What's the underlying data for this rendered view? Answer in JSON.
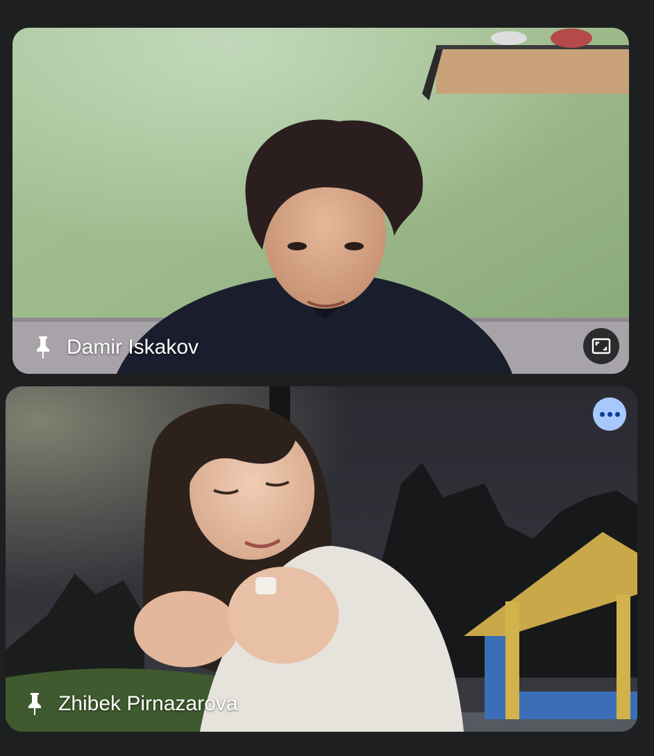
{
  "participants": [
    {
      "name": "Damir Iskakov"
    },
    {
      "name": "Zhibek Pirnazarova"
    }
  ],
  "icons": {
    "pin": "pin-icon",
    "fullscreen": "fullscreen-icon",
    "more": "more-options-icon"
  },
  "colors": {
    "background": "#1e1f20",
    "more_button": "#a8c7fa",
    "fullscreen_button": "#2a2b2d"
  }
}
